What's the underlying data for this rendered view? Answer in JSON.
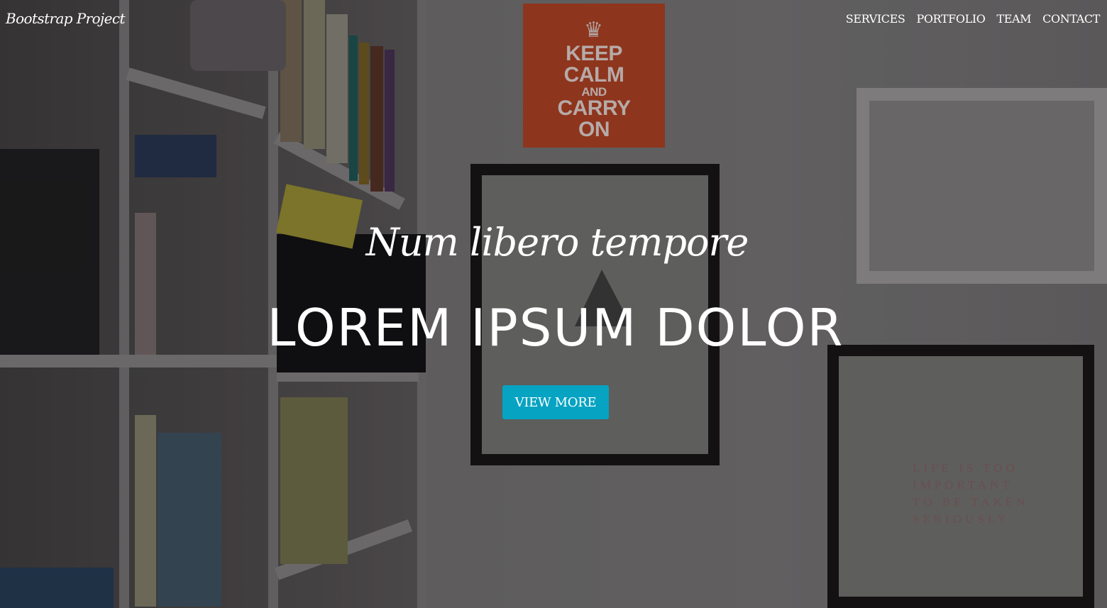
{
  "navbar": {
    "brand": "Bootstrap Project",
    "links": [
      {
        "label": "SERVICES"
      },
      {
        "label": "PORTFOLIO"
      },
      {
        "label": "TEAM"
      },
      {
        "label": "CONTACT"
      }
    ]
  },
  "hero": {
    "subtitle": "Num libero tempore",
    "title": "LOREM IPSUM DOLOR",
    "button_label": "VIEW MORE"
  },
  "background_photo": {
    "poster_lines": [
      "KEEP",
      "CALM",
      "AND",
      "CARRY",
      "ON"
    ],
    "framed_print_lines": [
      "LIFE IS TOO",
      "IMPORTANT",
      "TO BE TAKEN",
      "SERIOUSLY"
    ]
  },
  "colors": {
    "accent_button": "#06a3c2",
    "overlay": "rgba(0,0,0,0.55)",
    "text": "#ffffff"
  }
}
